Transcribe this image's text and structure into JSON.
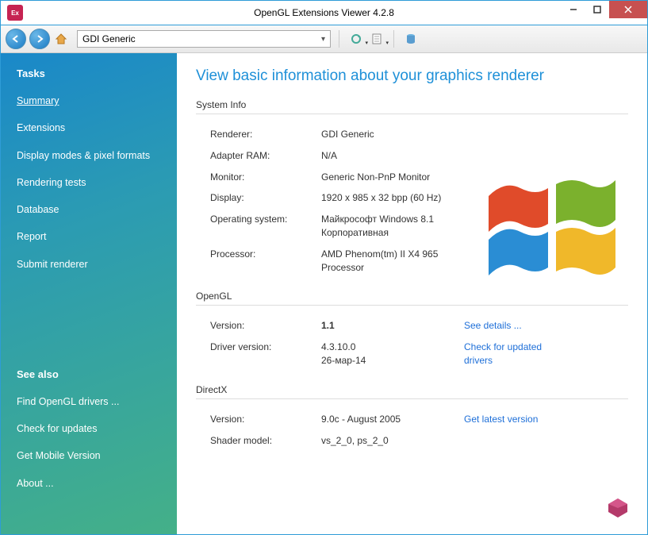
{
  "window": {
    "title": "OpenGL Extensions Viewer 4.2.8"
  },
  "toolbar": {
    "renderer_combo": "GDI Generic"
  },
  "sidebar": {
    "tasks_header": "Tasks",
    "tasks": [
      {
        "label": "Summary",
        "active": true
      },
      {
        "label": "Extensions"
      },
      {
        "label": "Display modes & pixel formats"
      },
      {
        "label": "Rendering tests"
      },
      {
        "label": "Database"
      },
      {
        "label": "Report"
      },
      {
        "label": "Submit renderer"
      }
    ],
    "seealso_header": "See also",
    "seealso": [
      {
        "label": "Find OpenGL drivers ..."
      },
      {
        "label": "Check for updates"
      },
      {
        "label": "Get Mobile Version"
      },
      {
        "label": "About ..."
      }
    ]
  },
  "content": {
    "title": "View basic information about your graphics renderer",
    "system_info": {
      "header": "System Info",
      "renderer_label": "Renderer:",
      "renderer_value": "GDI Generic",
      "ram_label": "Adapter RAM:",
      "ram_value": "N/A",
      "monitor_label": "Monitor:",
      "monitor_value": "Generic Non-PnP Monitor",
      "display_label": "Display:",
      "display_value": "1920 x 985 x 32 bpp (60 Hz)",
      "os_label": "Operating system:",
      "os_value": "Майкрософт Windows 8.1 Корпоративная",
      "cpu_label": "Processor:",
      "cpu_value": "AMD Phenom(tm) II X4 965 Processor"
    },
    "opengl": {
      "header": "OpenGL",
      "version_label": "Version:",
      "version_value": "1.1",
      "details_link": "See details ...",
      "driver_label": "Driver version:",
      "driver_value": "4.3.10.0\n26-мар-14",
      "driver_link": "Check for updated drivers"
    },
    "directx": {
      "header": "DirectX",
      "version_label": "Version:",
      "version_value": "9.0c - August 2005",
      "latest_link": "Get latest version",
      "shader_label": "Shader model:",
      "shader_value": "vs_2_0, ps_2_0"
    }
  }
}
